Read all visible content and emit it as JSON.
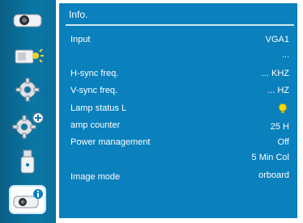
{
  "sidebar": {
    "items": [
      {
        "icon": "projector-icon",
        "active": false
      },
      {
        "icon": "projector-light-icon",
        "active": false
      },
      {
        "icon": "gear-icon",
        "active": false
      },
      {
        "icon": "gear-plus-icon",
        "active": false
      },
      {
        "icon": "usb-drive-icon",
        "active": false
      },
      {
        "icon": "projector-info-icon",
        "active": true
      }
    ]
  },
  "info": {
    "title": "Info.",
    "input": {
      "label": "Input",
      "value": "VGA1"
    },
    "input_extra": "...",
    "hsync": {
      "label": "H-sync freq.",
      "value": "... KHZ"
    },
    "vsync": {
      "label": "V-sync freq.",
      "value": "... HZ"
    },
    "lamp_status": {
      "label": "Lamp status  L",
      "icon": "lamp-bulb-icon"
    },
    "lamp_counter": {
      "label": "amp counter",
      "value": "25 H"
    },
    "power_management": {
      "label": "Power management",
      "value": "Off"
    },
    "power_extra": "5 Min  Col",
    "image_mode": {
      "label": "Image mode",
      "value": "orboard"
    }
  },
  "colors": {
    "sidebar": "#0a77a6",
    "panel": "#0a80bd",
    "text": "#ffffff",
    "bulb": "#f5d90a"
  }
}
